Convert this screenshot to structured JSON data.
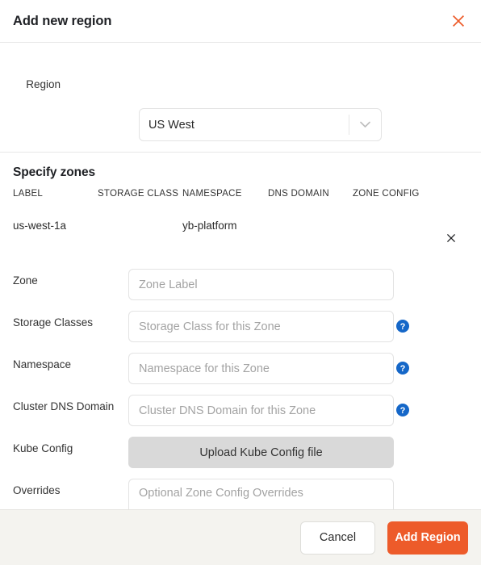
{
  "header": {
    "title": "Add new region",
    "close_icon": "close-icon"
  },
  "region": {
    "label": "Region",
    "selected": "US West",
    "chevron_icon": "chevron-down-icon"
  },
  "zones": {
    "heading": "Specify zones",
    "columns": [
      "LABEL",
      "STORAGE CLASS",
      "NAMESPACE",
      "DNS DOMAIN",
      "ZONE CONFIG"
    ],
    "rows": [
      {
        "label": "us-west-1a",
        "storage_class": "",
        "namespace": "yb-platform",
        "dns_domain": "",
        "zone_config": "",
        "delete_icon": "close-icon"
      }
    ]
  },
  "form": {
    "fields": [
      {
        "label": "Zone",
        "placeholder": "Zone Label",
        "value": "",
        "help": false
      },
      {
        "label": "Storage Classes",
        "placeholder": "Storage Class for this Zone",
        "value": "",
        "help": true
      },
      {
        "label": "Namespace",
        "placeholder": "Namespace for this Zone",
        "value": "",
        "help": true
      },
      {
        "label": "Cluster DNS Domain",
        "placeholder": "Cluster DNS Domain for this Zone",
        "value": "",
        "help": true
      }
    ],
    "kube_config": {
      "label": "Kube Config",
      "button_label": "Upload Kube Config file"
    },
    "overrides": {
      "label": "Overrides",
      "placeholder": "Optional Zone Config Overrides",
      "value": ""
    },
    "help_icon": "help-circle-icon"
  },
  "footer": {
    "cancel_label": "Cancel",
    "submit_label": "Add Region"
  },
  "colors": {
    "accent": "#ed5b2a",
    "help_blue": "#1567c8",
    "footer_bg": "#f4f3ef",
    "upload_bg": "#d9d9d9"
  }
}
